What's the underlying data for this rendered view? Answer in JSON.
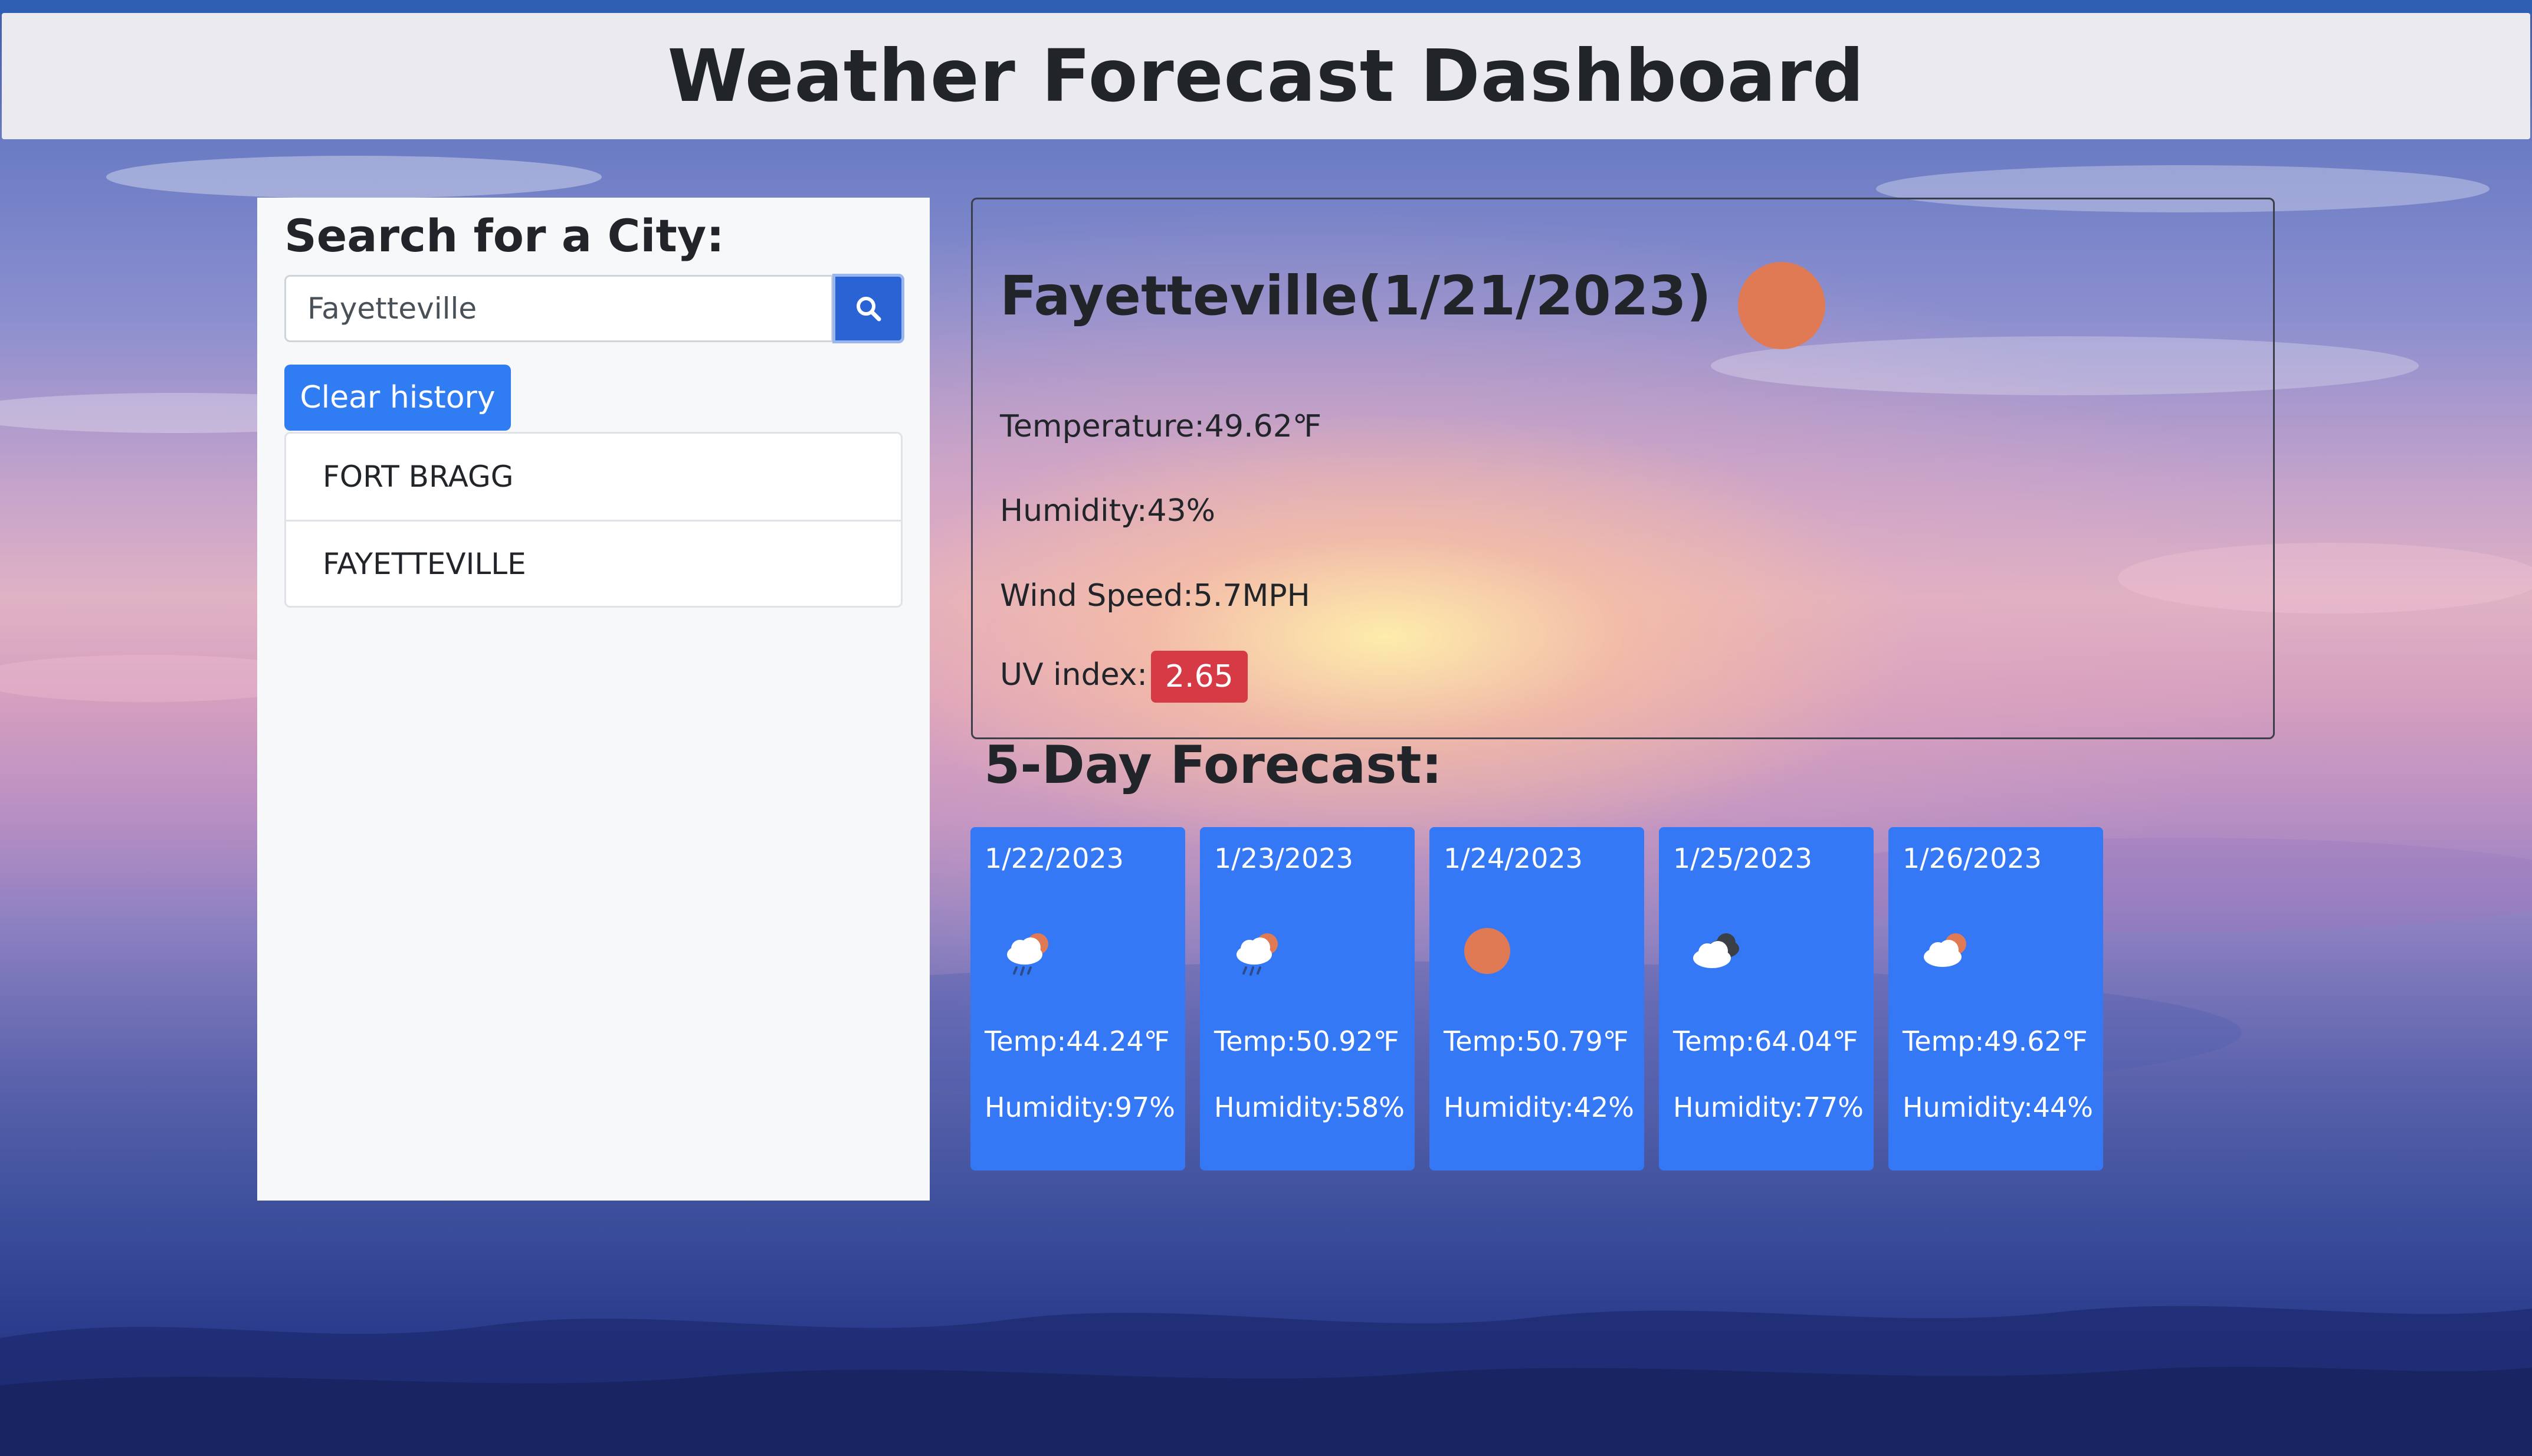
{
  "header": {
    "title": "Weather Forecast Dashboard"
  },
  "sidebar": {
    "search_label": "Search for a City:",
    "search_value": "Fayetteville",
    "search_button_icon": "search-icon",
    "clear_label": "Clear history",
    "history": [
      "FORT BRAGG",
      "FAYETTEVILLE"
    ]
  },
  "current": {
    "title": "Fayetteville(1/21/2023)",
    "icon": "sun-icon",
    "temperature": "Temperature:49.62℉",
    "humidity": "Humidity:43%",
    "wind": "Wind Speed:5.7MPH",
    "uv_label": "UV index:",
    "uv_value": "2.65"
  },
  "forecast": {
    "title": "5-Day Forecast:",
    "days": [
      {
        "date": "1/22/2023",
        "icon": "rain-icon",
        "temp": "Temp:44.24℉",
        "humidity": "Humidity:97%"
      },
      {
        "date": "1/23/2023",
        "icon": "rain-icon",
        "temp": "Temp:50.92℉",
        "humidity": "Humidity:58%"
      },
      {
        "date": "1/24/2023",
        "icon": "sun-icon",
        "temp": "Temp:50.79℉",
        "humidity": "Humidity:42%"
      },
      {
        "date": "1/25/2023",
        "icon": "clouds-icon",
        "temp": "Temp:64.04℉",
        "humidity": "Humidity:77%"
      },
      {
        "date": "1/26/2023",
        "icon": "partly-cloudy-icon",
        "temp": "Temp:49.62℉",
        "humidity": "Humidity:44%"
      }
    ]
  },
  "colors": {
    "header_bg": "#ebebef",
    "primary_button": "#2f7cf3",
    "card_bg": "#3478f5",
    "uv_badge": "#d63a45",
    "sun": "#e07a55"
  }
}
